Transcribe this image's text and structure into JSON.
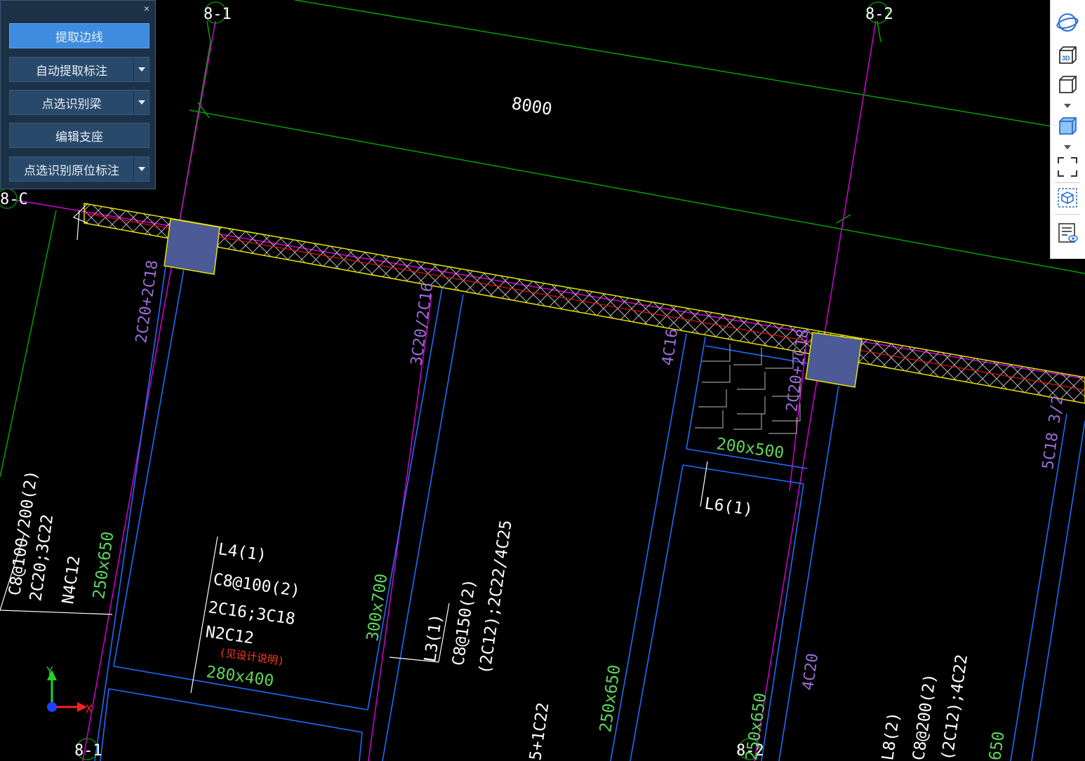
{
  "toolPanel": {
    "close": "×",
    "buttons": [
      {
        "label": "提取边线",
        "active": true,
        "hasDropdown": false
      },
      {
        "label": "自动提取标注",
        "active": false,
        "hasDropdown": true
      },
      {
        "label": "点选识别梁",
        "active": false,
        "hasDropdown": true
      },
      {
        "label": "编辑支座",
        "active": false,
        "hasDropdown": false
      },
      {
        "label": "点选识别原位标注",
        "active": false,
        "hasDropdown": true
      }
    ]
  },
  "viewToolbar": {
    "items": [
      "orbit-icon",
      "view-3d-icon",
      "box-view-icon",
      "shaded-box-icon",
      "fit-view-icon",
      "section-box-icon",
      "display-settings-icon"
    ],
    "badge3d": "3D"
  },
  "drawing": {
    "axes": {
      "top_1": "8-1",
      "top_2": "8-2",
      "left_c": "8-C",
      "bottom_1": "8-1",
      "bottom_2": "8-2"
    },
    "dimension": "8000",
    "beamLabels": {
      "b1_top": "2C20+2C18",
      "b2_top": "3C20/2C16",
      "b3_top": "4C16",
      "b4_top": "2C20+2C18",
      "b5_top": "5C18 3/2",
      "l4_name": "L4(1)",
      "l4_stirrup": "C8@100(2)",
      "l4_bars": "2C16;3C18",
      "l4_torsion": "N2C12",
      "l4_note": "(见设计说明)",
      "l4_size": "280x400",
      "left_stirrup": "C8@100/200(2)",
      "left_bars": "2C20;3C22",
      "left_torsion": "N4C12",
      "left_size": "250x650",
      "size_300x700": "300x700",
      "l3_name": "L3(1)",
      "l3_stirrup": "C8@150(2)",
      "l3_bars": "(2C12);2C22/4C25",
      "size_200x500": "200x500",
      "l6_name": "L6(1)",
      "bottom_bars": "5+1C22",
      "size_250x650_b": "250x650",
      "size_250x650_c": "250x650",
      "bars_4c20": "4C20",
      "l8_name": "L8(2)",
      "l8_stirrup": "C8@200(2)",
      "l8_bars": "(2C12);4C22",
      "size_650": "650"
    },
    "ucs": {
      "y": "Y",
      "x": "X"
    }
  },
  "colors": {
    "axis": "#d400d4",
    "dimLine": "#00a000",
    "beamEdge": "#1e6bff",
    "wallEdge": "#e6e600",
    "column": "#4c5a98",
    "labelPurple": "#9c6cd8",
    "labelGreen": "#5cd65c",
    "labelWhite": "#ffffff",
    "noteRed": "#ff3b1f",
    "panelBg": "#1d3146",
    "panelBtn": "#29496a",
    "panelActive": "#3f8bdf"
  }
}
